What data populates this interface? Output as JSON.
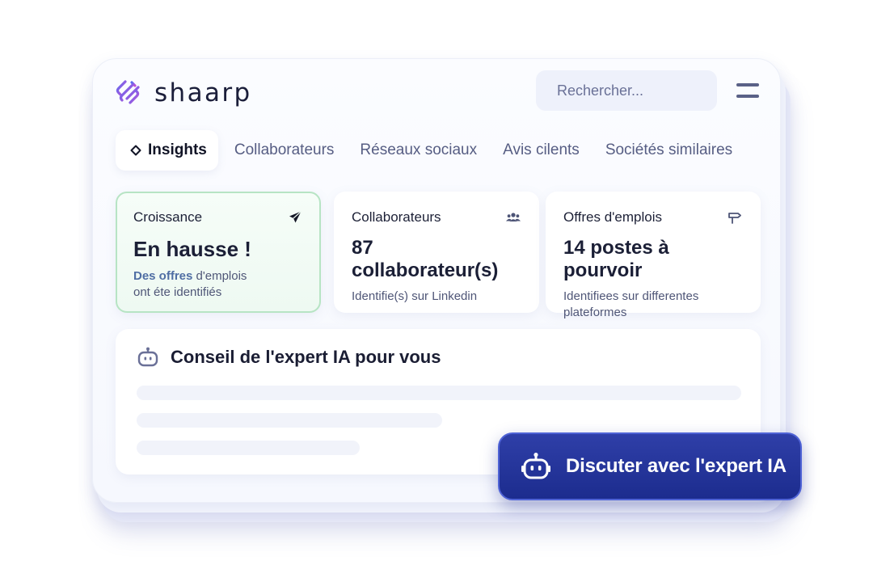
{
  "brand": {
    "name": "shaarp"
  },
  "search": {
    "placeholder": "Rechercher..."
  },
  "tabs": [
    {
      "label": "Insights",
      "active": true
    },
    {
      "label": "Collaborateurs"
    },
    {
      "label": "Réseaux sociaux"
    },
    {
      "label": "Avis cilents"
    },
    {
      "label": "Sociétés similaires"
    }
  ],
  "cards": [
    {
      "title": "Croissance",
      "icon": "rocket-icon",
      "value": "En hausse !",
      "sub_highlight": "Des offres",
      "sub_rest_1": " d'emplois",
      "sub_line_2": "ont éte identifiés"
    },
    {
      "title": "Collaborateurs",
      "icon": "users-icon",
      "value": "87 collaborateur(s)",
      "sub": "Identifie(s) sur Linkedin"
    },
    {
      "title": "Offres d'emplois",
      "icon": "signpost-icon",
      "value": "14 postes à pourvoir",
      "sub": "Identifiees sur differentes plateformes"
    }
  ],
  "advice": {
    "title": "Conseil de l'expert IA pour vous",
    "icon": "robot-icon"
  },
  "cta": {
    "label": "Discuter avec l'expert IA",
    "icon": "robot-icon"
  },
  "colors": {
    "accent": "#2434a0",
    "growth_border": "#b7e4c4",
    "text_primary": "#1b1f36",
    "text_muted": "#565d83"
  }
}
